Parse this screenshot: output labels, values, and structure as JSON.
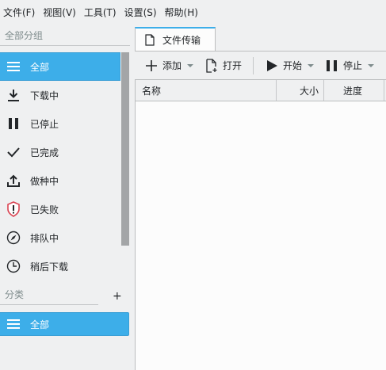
{
  "menubar": {
    "items": [
      "文件(F)",
      "视图(V)",
      "工具(T)",
      "设置(S)",
      "帮助(H)"
    ]
  },
  "sidebar": {
    "groups_header": "全部分组",
    "items": [
      {
        "label": "全部",
        "icon": "menu-icon",
        "active": true
      },
      {
        "label": "下载中",
        "icon": "download-icon"
      },
      {
        "label": "已停止",
        "icon": "pause-icon"
      },
      {
        "label": "已完成",
        "icon": "checkmark-icon"
      },
      {
        "label": "做种中",
        "icon": "upload-icon"
      },
      {
        "label": "已失败",
        "icon": "error-shield-icon"
      },
      {
        "label": "排队中",
        "icon": "compass-icon"
      },
      {
        "label": "稍后下载",
        "icon": "clock-icon"
      }
    ],
    "categories_header": "分类",
    "add_category": "+",
    "categories": [
      {
        "label": "全部",
        "icon": "menu-icon",
        "active": true
      }
    ]
  },
  "main": {
    "tab_label": "文件传输",
    "toolbar": {
      "add_label": "添加",
      "open_label": "打开",
      "start_label": "开始",
      "stop_label": "停止"
    },
    "table_headers": [
      "名称",
      "大小",
      "进度"
    ]
  },
  "colors": {
    "accent": "#3daee9",
    "window_bg": "#eff0f1",
    "view_bg": "#fcfcfc",
    "error": "#da4453"
  }
}
